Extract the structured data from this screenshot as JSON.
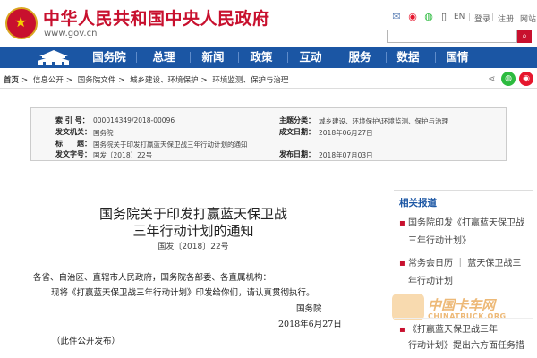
{
  "header": {
    "title": "中华人民共和国中央人民政府",
    "url": "www.gov.cn",
    "links": [
      "EN",
      "登录",
      "注册",
      "网站"
    ],
    "icons": [
      "mail-icon",
      "weibo-icon",
      "wechat-icon",
      "mobile-icon"
    ]
  },
  "nav": {
    "items": [
      "国务院",
      "总理",
      "新闻",
      "政策",
      "互动",
      "服务",
      "数据",
      "国情"
    ]
  },
  "breadcrumb": [
    "首页",
    "信息公开",
    "国务院文件",
    "城乡建设、环境保护",
    "环境监测、保护与治理"
  ],
  "info": {
    "labels": {
      "index_no": "索 引 号：",
      "issuer": "发文机关：",
      "title": "标　　题：",
      "doc_no": "发文字号：",
      "subject": "主题分类：",
      "date_made": "成文日期：",
      "date_pub": "发布日期："
    },
    "index_no": "000014349/2018-00096",
    "issuer": "国务院",
    "title": "国务院关于印发打赢蓝天保卫战三年行动计划的通知",
    "doc_no": "国发〔2018〕22号",
    "subject": "城乡建设、环境保护\\环境监测、保护与治理",
    "date_made": "2018年06月27日",
    "date_pub": "2018年07月03日"
  },
  "article": {
    "title_line1": "国务院关于印发打赢蓝天保卫战",
    "title_line2": "三年行动计划的通知",
    "doc_no": "国发〔2018〕22号",
    "recipients": "各省、自治区、直辖市人民政府，国务院各部委、各直属机构：",
    "body": "现将《打赢蓝天保卫战三年行动计划》印发给你们，请认真贯彻执行。",
    "signature": "国务院",
    "date": "2018年6月27日",
    "note": "（此件公开发布）"
  },
  "related": {
    "title": "相关报道",
    "items": [
      {
        "l1": "国务院印发《打赢蓝天保卫战",
        "l2": "三年行动计划》"
      },
      {
        "l1": "常务会日历 ｜ 蓝天保卫战三",
        "l2": "年行动计划"
      },
      {
        "l1": "《打赢蓝天保卫战三年",
        "l2": "行动计划》提出六方面任务措"
      }
    ]
  },
  "watermark": {
    "cn": "中国卡车网",
    "en": "CHINATRUCK.ORG"
  },
  "colors": {
    "brand_red": "#c8102e",
    "nav_blue": "#1b56a4"
  }
}
